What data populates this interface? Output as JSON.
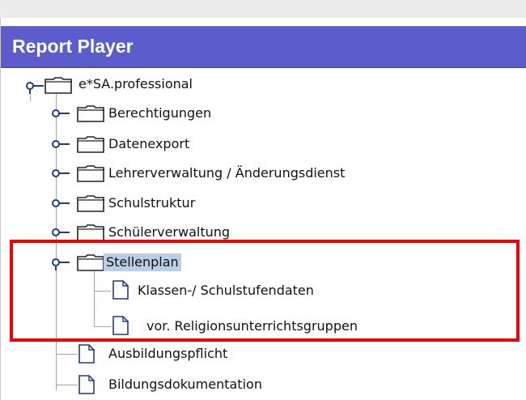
{
  "header": {
    "title": "Report Player"
  },
  "tree": {
    "root": {
      "label": "e*SA.professional",
      "expanded": true
    },
    "items": [
      {
        "label": "Berechtigungen",
        "type": "folder",
        "expanded": false
      },
      {
        "label": "Datenexport",
        "type": "folder",
        "expanded": false
      },
      {
        "label": "Lehrerverwaltung / Änderungsdienst",
        "type": "folder",
        "expanded": false
      },
      {
        "label": "Schulstruktur",
        "type": "folder",
        "expanded": false
      },
      {
        "label": "Schülerverwaltung",
        "type": "folder",
        "expanded": false
      },
      {
        "label": "Stellenplan",
        "type": "folder",
        "expanded": true,
        "selected": true,
        "children": [
          {
            "label": "Klassen-/ Schulstufendaten",
            "type": "document"
          },
          {
            "label": "vor. Religionsunterrichtsgruppen",
            "type": "document"
          }
        ]
      },
      {
        "label": "Ausbildungspflicht",
        "type": "document"
      },
      {
        "label": "Bildungsdokumentation",
        "type": "document"
      }
    ]
  },
  "colors": {
    "header_bg": "#5c5ccd",
    "selection_bg": "#b9cfe8",
    "highlight_border": "#ee0000",
    "handle_color": "#1f3f7a"
  }
}
